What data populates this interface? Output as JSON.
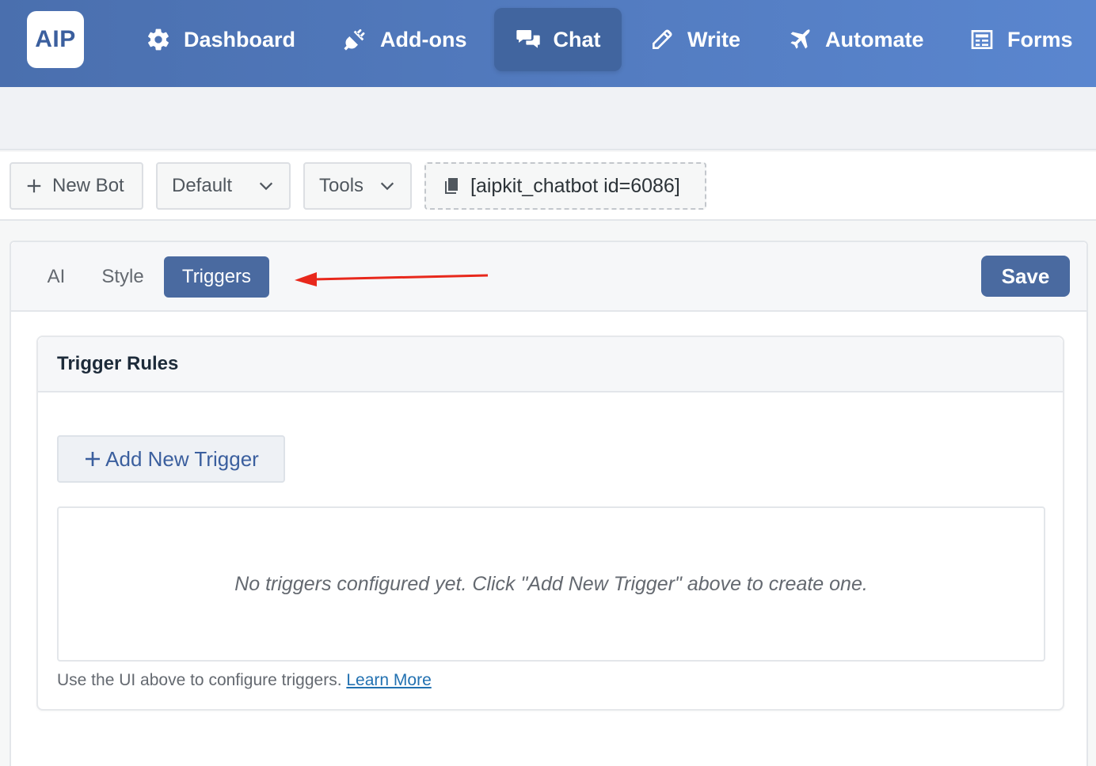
{
  "brand": {
    "logo_text": "AIP"
  },
  "nav": {
    "items": [
      {
        "label": "Dashboard",
        "icon": "gear-icon"
      },
      {
        "label": "Add-ons",
        "icon": "plug-icon"
      },
      {
        "label": "Chat",
        "icon": "chat-icon",
        "active": true
      },
      {
        "label": "Write",
        "icon": "pencil-icon"
      },
      {
        "label": "Automate",
        "icon": "plane-icon"
      },
      {
        "label": "Forms",
        "icon": "form-icon"
      }
    ]
  },
  "toolbar": {
    "new_bot_label": "New Bot",
    "bot_select_value": "Default",
    "tools_label": "Tools",
    "shortcode": "[aipkit_chatbot id=6086]"
  },
  "tabs": {
    "items": [
      {
        "label": "AI"
      },
      {
        "label": "Style"
      },
      {
        "label": "Triggers",
        "active": true
      }
    ],
    "save_label": "Save"
  },
  "triggers": {
    "card_title": "Trigger Rules",
    "add_button_label": "Add New Trigger",
    "empty_message": "No triggers configured yet. Click \"Add New Trigger\" above to create one.",
    "help_text": "Use the UI above to configure triggers.",
    "learn_more_label": "Learn More"
  },
  "colors": {
    "nav_gradient_start": "#4a6fae",
    "nav_gradient_end": "#5a86cf",
    "accent": "#4a6aa0",
    "annotation_arrow": "#e8281c",
    "link": "#2271b1"
  }
}
